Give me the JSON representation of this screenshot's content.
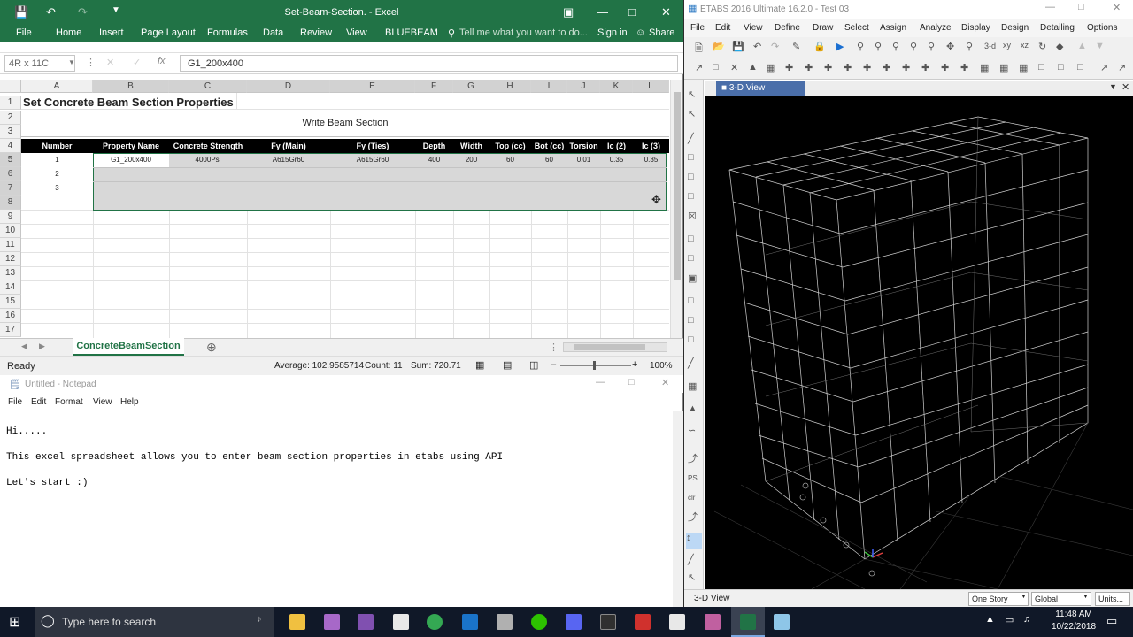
{
  "excel": {
    "window_title": "Set-Beam-Section. - Excel",
    "menu": [
      "File",
      "Home",
      "Insert",
      "Page Layout",
      "Formulas",
      "Data",
      "Review",
      "View",
      "BLUEBEAM"
    ],
    "tell_me": "Tell me what you want to do...",
    "sign_in": "Sign in",
    "share": "Share",
    "name_box": "4R x 11C",
    "formula": "G1_200x400",
    "columns": [
      "A",
      "B",
      "C",
      "D",
      "E",
      "F",
      "G",
      "H",
      "I",
      "J",
      "K",
      "L"
    ],
    "rows": [
      "1",
      "2",
      "3",
      "4",
      "5",
      "6",
      "7",
      "8",
      "9",
      "10",
      "11",
      "12",
      "13",
      "14",
      "15",
      "16",
      "17"
    ],
    "sheet_title": "Set Concrete Beam Section Properties",
    "button_label": "Write Beam Section",
    "headers": [
      "Number",
      "Property Name",
      "Concrete Strength",
      "Fy (Main)",
      "Fy (Ties)",
      "Depth",
      "Width",
      "Top (cc)",
      "Bot (cc)",
      "Torsion",
      "Ic (2)",
      "Ic (3)"
    ],
    "row1": [
      "1",
      "G1_200x400",
      "4000Psi",
      "A615Gr60",
      "A615Gr60",
      "400",
      "200",
      "60",
      "60",
      "0.01",
      "0.35",
      "0.35"
    ],
    "row2_num": "2",
    "row3_num": "3",
    "sheet_tab": "ConcreteBeamSection",
    "status_ready": "Ready",
    "status_average": "Average: 102.9585714",
    "status_count": "Count: 11",
    "status_sum": "Sum: 720.71",
    "zoom": "100%",
    "accent": "#217346"
  },
  "notepad": {
    "window_title": "Untitled - Notepad",
    "menu": [
      "File",
      "Edit",
      "Format",
      "View",
      "Help"
    ],
    "lines": [
      "Hi.....",
      "This excel spreadsheet allows you to enter beam section properties in etabs using API",
      "Let's start :)"
    ]
  },
  "etabs": {
    "window_title": "ETABS 2016 Ultimate 16.2.0 - Test 03",
    "menu": [
      "File",
      "Edit",
      "View",
      "Define",
      "Draw",
      "Select",
      "Assign",
      "Analyze",
      "Display",
      "Design",
      "Detailing",
      "Options"
    ],
    "view_tab": "3-D View",
    "status_view": "3-D View",
    "story_select": "One Story",
    "coord_select": "Global",
    "units_button": "Units..."
  },
  "taskbar": {
    "search_placeholder": "Type here to search",
    "time": "11:48 AM",
    "date": "10/22/2018"
  }
}
